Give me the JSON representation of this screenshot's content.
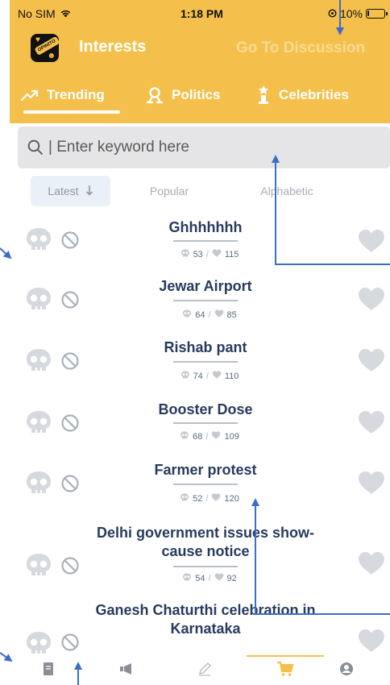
{
  "status_bar": {
    "carrier": "No SIM",
    "time": "1:18 PM",
    "battery": "10%",
    "battery_level": 0.1
  },
  "header": {
    "app_title": "Interests",
    "goto_label": "Go To Discussion",
    "logo_text": "OPINITO"
  },
  "tabs": [
    {
      "label": "Trending",
      "icon": "trending-icon",
      "active": true
    },
    {
      "label": "Politics",
      "icon": "politics-icon",
      "active": false
    },
    {
      "label": "Celebrities",
      "icon": "celebrities-icon",
      "active": false
    }
  ],
  "search": {
    "placeholder": "| Enter keyword here",
    "value": ""
  },
  "sort": {
    "latest": "Latest",
    "popular": "Popular",
    "alphabetic": "Alphabetic",
    "active": "latest"
  },
  "topics": [
    {
      "title": "Ghhhhhhh",
      "dislikes": "53",
      "likes": "115"
    },
    {
      "title": "Jewar Airport",
      "dislikes": "64",
      "likes": "85"
    },
    {
      "title": "Rishab pant",
      "dislikes": "74",
      "likes": "110"
    },
    {
      "title": "Booster Dose",
      "dislikes": "68",
      "likes": "109"
    },
    {
      "title": "Farmer protest",
      "dislikes": "52",
      "likes": "120"
    },
    {
      "title": "Delhi government issues show-cause notice",
      "dislikes": "54",
      "likes": "92"
    },
    {
      "title": "Ganesh Chaturthi celebration in Karnataka",
      "dislikes": "",
      "likes": ""
    }
  ],
  "bottom_tabs": [
    {
      "icon": "document-icon",
      "active": false
    },
    {
      "icon": "megaphone-icon",
      "active": false
    },
    {
      "icon": "pencil-icon",
      "active": false
    },
    {
      "icon": "cart-icon",
      "active": true
    },
    {
      "icon": "profile-icon",
      "active": false
    }
  ],
  "colors": {
    "accent": "#f4c04b",
    "title_text": "#283b5e",
    "muted_icon": "#d6d9de",
    "annotation": "#3d6ec7"
  }
}
